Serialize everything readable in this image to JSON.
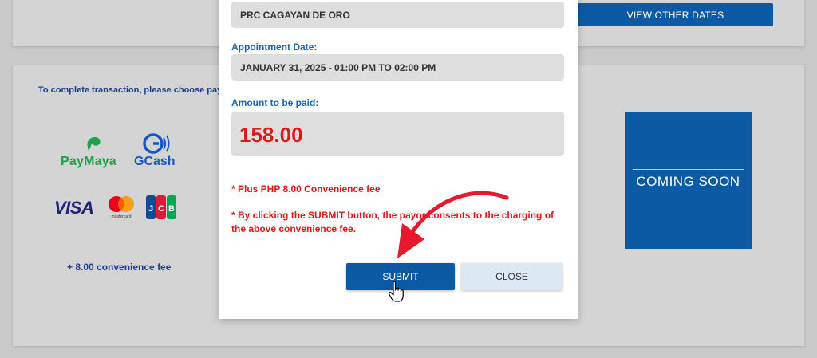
{
  "background_page": {
    "view_other_dates_label": "VIEW OTHER DATES",
    "choose_payment_text": "To complete transaction, please choose paym",
    "paymaya_label": "PayMaya",
    "gcash_label": "GCash",
    "visa_label": "VISA",
    "mastercard_label": "mastercard",
    "jcb_label": "JCB",
    "convenience_fee_text": "+ 8.00 convenience fee",
    "coming_soon_label": "COMING SOON"
  },
  "modal": {
    "branch_value": "PRC CAGAYAN DE ORO",
    "date_label": "Appointment Date:",
    "date_value": "JANUARY 31, 2025 - 01:00 PM TO 02:00 PM",
    "amount_label": "Amount to be paid:",
    "amount_value": "158.00",
    "note_fee": "* Plus PHP 8.00 Convenience fee",
    "note_consent": "* By clicking the SUBMIT button, the payor consents to the charging of the above convenience fee.",
    "submit_label": "SUBMIT",
    "close_label": "CLOSE"
  },
  "colors": {
    "brand_blue": "#0d5aa4",
    "alert_red": "#e01a1a",
    "label_blue": "#1a64b8",
    "annotation_red": "#e8192c"
  },
  "icons": [
    "paymaya-logo-icon",
    "gcash-logo-icon",
    "visa-logo-icon",
    "mastercard-logo-icon",
    "jcb-logo-icon",
    "red-arrow-annotation-icon",
    "hand-pointer-cursor-icon"
  ]
}
